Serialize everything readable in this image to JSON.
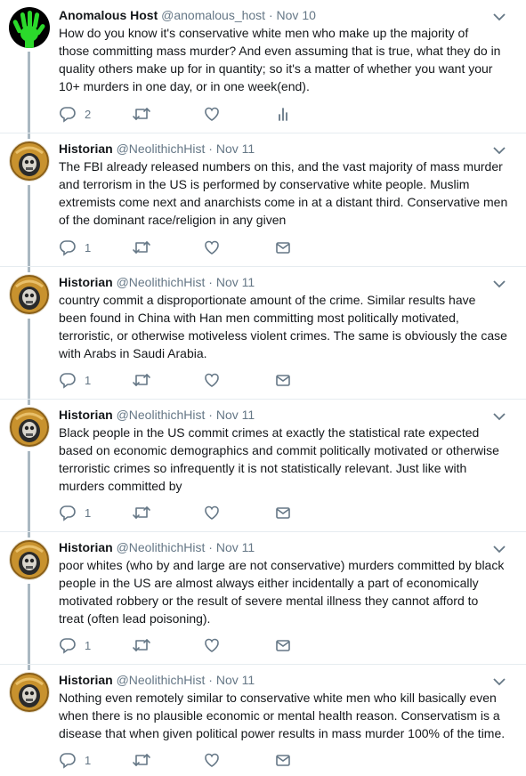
{
  "tweets": [
    {
      "avatar": "green-hand-avatar",
      "name": "Anomalous Host",
      "handle": "@anomalous_host",
      "dot": "·",
      "date": "Nov 10",
      "lines": [
        "How do you know it's conservative white men who make up the majority of",
        "those committing mass murder?  And even assuming that is true, what they do in",
        "quality others make up for in quantity; so it's a matter of whether you want your",
        "10+ murders in one day, or in one week(end)."
      ],
      "reply_count": "2",
      "last_action": "analytics-icon"
    },
    {
      "avatar": "astronaut-skull-avatar",
      "name": "Historian",
      "handle": "@NeolithichHist",
      "dot": "·",
      "date": "Nov 11",
      "lines": [
        "The FBI already released numbers on this, and the vast majority of mass murder",
        "and terrorism in the US is performed by conservative white people. Muslim",
        "extremists come next and anarchists come in at a distant third. Conservative men",
        "of the dominant race/religion in any given"
      ],
      "reply_count": "1",
      "last_action": "mail-icon"
    },
    {
      "avatar": "astronaut-skull-avatar",
      "name": "Historian",
      "handle": "@NeolithichHist",
      "dot": "·",
      "date": "Nov 11",
      "lines": [
        "country commit a disproportionate amount of the crime. Similar results have",
        "been found in China with Han men committing most politically motivated,",
        "terroristic, or otherwise motiveless violent crimes. The same is obviously the case",
        "with Arabs in Saudi Arabia."
      ],
      "reply_count": "1",
      "last_action": "mail-icon"
    },
    {
      "avatar": "astronaut-skull-avatar",
      "name": "Historian",
      "handle": "@NeolithichHist",
      "dot": "·",
      "date": "Nov 11",
      "lines": [
        "Black people in the US commit crimes at exactly the statistical rate expected",
        "based on economic demographics and commit politically motivated or otherwise",
        "terroristic crimes so infrequently it is not statistically relevant. Just like with",
        "murders committed by"
      ],
      "reply_count": "1",
      "last_action": "mail-icon"
    },
    {
      "avatar": "astronaut-skull-avatar",
      "name": "Historian",
      "handle": "@NeolithichHist",
      "dot": "·",
      "date": "Nov 11",
      "lines": [
        "poor whites (who by and large are not conservative) murders committed by black",
        "people in the US are almost always either incidentally a part of economically",
        "motivated robbery or the result of severe mental illness they cannot afford to",
        "treat (often lead poisoning)."
      ],
      "reply_count": "1",
      "last_action": "mail-icon"
    },
    {
      "avatar": "astronaut-skull-avatar",
      "name": "Historian",
      "handle": "@NeolithichHist",
      "dot": "·",
      "date": "Nov 11",
      "lines": [
        "Nothing even remotely similar to conservative white men who kill basically even",
        "when there is no plausible economic or mental health reason. Conservatism is a",
        "disease that when given political power results in mass murder 100% of the time."
      ],
      "reply_count": "1",
      "last_action": "mail-icon"
    }
  ],
  "colors": {
    "text": "#14171a",
    "muted": "#657786",
    "thread_line": "#aab8c2",
    "divider": "#e6ecf0",
    "avatar1_bg": "#000000",
    "avatar1_hand": "#2bd92b",
    "avatar2_helmet": "#c8922e"
  }
}
